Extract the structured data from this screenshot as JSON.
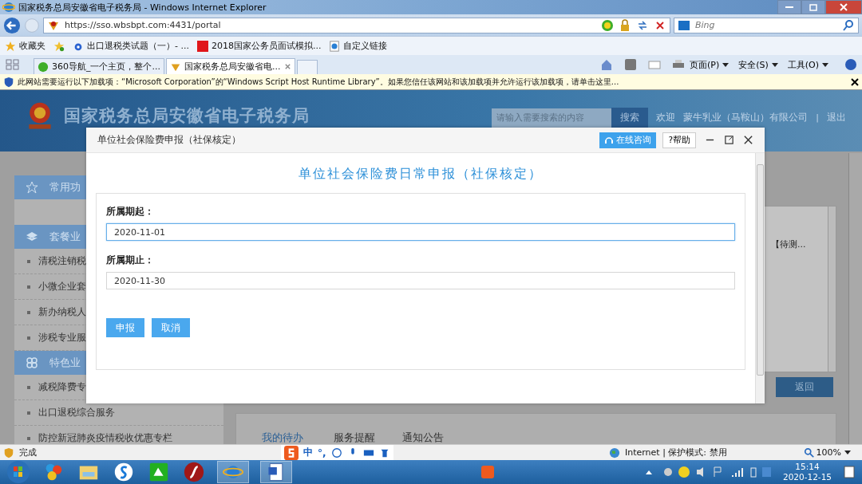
{
  "browser": {
    "title": "国家税务总局安徽省电子税务局 - Windows Internet Explorer",
    "url": "https://sso.wbsbpt.com:4431/portal",
    "search_placeholder": "Bing",
    "favorites": [
      "收藏夹",
      "出口退税类试题（一）- ...",
      "2018国家公务员面试模拟...",
      "自定义链接"
    ],
    "tabs": [
      {
        "label": "360导航_一个主页，整个...",
        "selected": false
      },
      {
        "label": "国家税务总局安徽省电...",
        "selected": true
      }
    ],
    "commands": [
      "页面(P)",
      "安全(S)",
      "工具(O)"
    ],
    "info_bar": "此网站需要运行以下加载项：“Microsoft Corporation”的“Windows Script Host Runtime Library”。如果您信任该网站和该加载项并允许运行该加载项，请单击这里..."
  },
  "site": {
    "title": "国家税务总局安徽省电子税务局",
    "search_placeholder": "请输入需要搜索的内容",
    "search_button": "搜索",
    "welcome": "欢迎",
    "company": "蒙牛乳业（马鞍山）有限公司",
    "separator": "|",
    "logout": "退出"
  },
  "sidebar": [
    {
      "label": "常用功"
    },
    {
      "label": "套餐业",
      "items": [
        "清税注销税",
        "小微企业套",
        "新办纳税人",
        "涉税专业服"
      ]
    },
    {
      "label": "特色业",
      "items": [
        "减税降费专",
        "出口退税综合服务",
        "防控新冠肺炎疫情税收优惠专栏"
      ]
    }
  ],
  "content": {
    "pending_text": "【待测...",
    "back_button": "返回",
    "tabs": [
      {
        "label": "我的待办",
        "selected": true
      },
      {
        "label": "服务提醒",
        "selected": false
      },
      {
        "label": "通知公告",
        "selected": false
      }
    ]
  },
  "dialog": {
    "title": "单位社会保险费申报（社保核定）",
    "consult_button": "在线咨询",
    "help_button": "?帮助",
    "heading": "单位社会保险费日常申报（社保核定）",
    "fields": [
      {
        "label": "所属期起：",
        "value": "2020-11-01",
        "focused": true
      },
      {
        "label": "所属期止：",
        "value": "2020-11-30",
        "focused": false
      }
    ],
    "buttons": [
      "申报",
      "取消"
    ]
  },
  "status_bar": {
    "text": "完成",
    "ime": [
      "中",
      "°,"
    ],
    "zone": "Internet | 保护模式: 禁用",
    "zoom": "100%"
  },
  "taskbar": {
    "time": "15:14",
    "date": "2020-12-15"
  }
}
